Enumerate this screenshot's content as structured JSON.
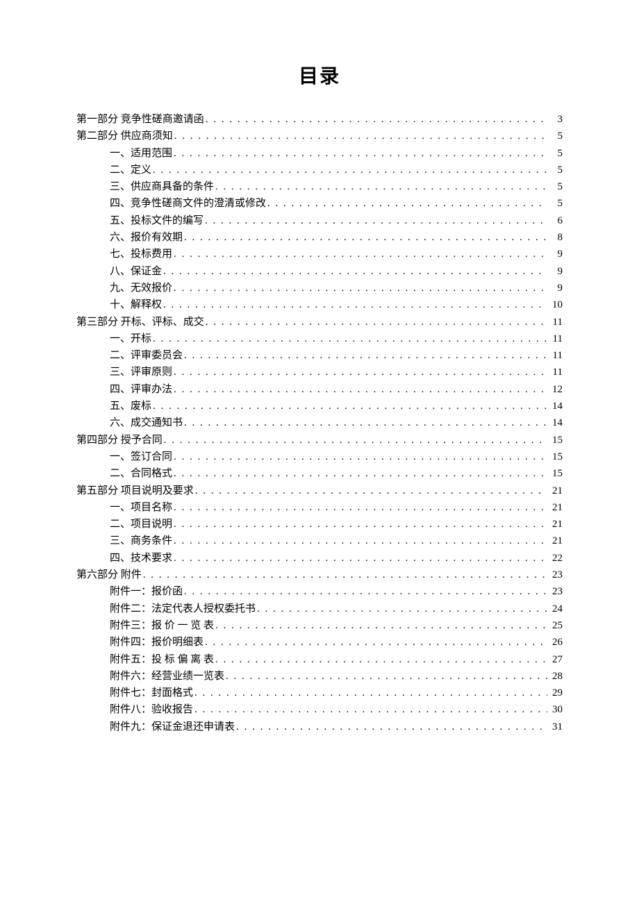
{
  "title": "目录",
  "entries": [
    {
      "level": 1,
      "label": "第一部分  竞争性磋商邀请函 ",
      "page": "3"
    },
    {
      "level": 1,
      "label": "第二部分  供应商须知 ",
      "page": "5"
    },
    {
      "level": 2,
      "label": "一、适用范围",
      "page": "5"
    },
    {
      "level": 2,
      "label": "二、定义",
      "page": "5"
    },
    {
      "level": 2,
      "label": "三、供应商具备的条件",
      "page": "5"
    },
    {
      "level": 2,
      "label": "四、竞争性磋商文件的澄清或修改",
      "page": "5"
    },
    {
      "level": 2,
      "label": "五、投标文件的编写",
      "page": "6"
    },
    {
      "level": 2,
      "label": "六、报价有效期",
      "page": "8"
    },
    {
      "level": 2,
      "label": "七、投标费用",
      "page": "9"
    },
    {
      "level": 2,
      "label": "八、保证金",
      "page": "9"
    },
    {
      "level": 2,
      "label": "九、无效报价",
      "page": "9"
    },
    {
      "level": 2,
      "label": "十、解释权",
      "page": "10"
    },
    {
      "level": 1,
      "label": "第三部分  开标、评标、成交 ",
      "page": "11"
    },
    {
      "level": 2,
      "label": "一、开标",
      "page": "11"
    },
    {
      "level": 2,
      "label": "二、评审委员会",
      "page": "11"
    },
    {
      "level": 2,
      "label": "三、评审原则",
      "page": "11"
    },
    {
      "level": 2,
      "label": "四、评审办法",
      "page": "12"
    },
    {
      "level": 2,
      "label": "五、废标",
      "page": "14"
    },
    {
      "level": 2,
      "label": "六、成交通知书",
      "page": "14"
    },
    {
      "level": 1,
      "label": "第四部分  授予合同 ",
      "page": "15"
    },
    {
      "level": 2,
      "label": "一、签订合同",
      "page": "15"
    },
    {
      "level": 2,
      "label": "二、合同格式",
      "page": "15"
    },
    {
      "level": 1,
      "label": "第五部分  项目说明及要求 ",
      "page": "21"
    },
    {
      "level": 2,
      "label": "一、项目名称",
      "page": "21"
    },
    {
      "level": 2,
      "label": "二、项目说明",
      "page": "21"
    },
    {
      "level": 2,
      "label": "三、商务条件",
      "page": "21"
    },
    {
      "level": 2,
      "label": "四、技术要求",
      "page": "22"
    },
    {
      "level": 1,
      "label": "第六部分    附件 ",
      "page": "23"
    },
    {
      "level": 2,
      "label": "附件一：报价函",
      "page": "23"
    },
    {
      "level": 2,
      "label": "附件二：法定代表人授权委托书",
      "page": "24"
    },
    {
      "level": 2,
      "label": "附件三：报   价 一 览 表",
      "page": "25"
    },
    {
      "level": 2,
      "label": "附件四：报价明细表",
      "page": "26"
    },
    {
      "level": 2,
      "label": "附件五：投 标 偏 离 表",
      "page": "27"
    },
    {
      "level": 2,
      "label": "附件六：经营业绩一览表",
      "page": "28"
    },
    {
      "level": 2,
      "label": "附件七：封面格式",
      "page": "29"
    },
    {
      "level": 2,
      "label": "附件八：验收报告",
      "page": "30"
    },
    {
      "level": 2,
      "label": "附件九：保证金退还申请表",
      "page": "31"
    }
  ]
}
